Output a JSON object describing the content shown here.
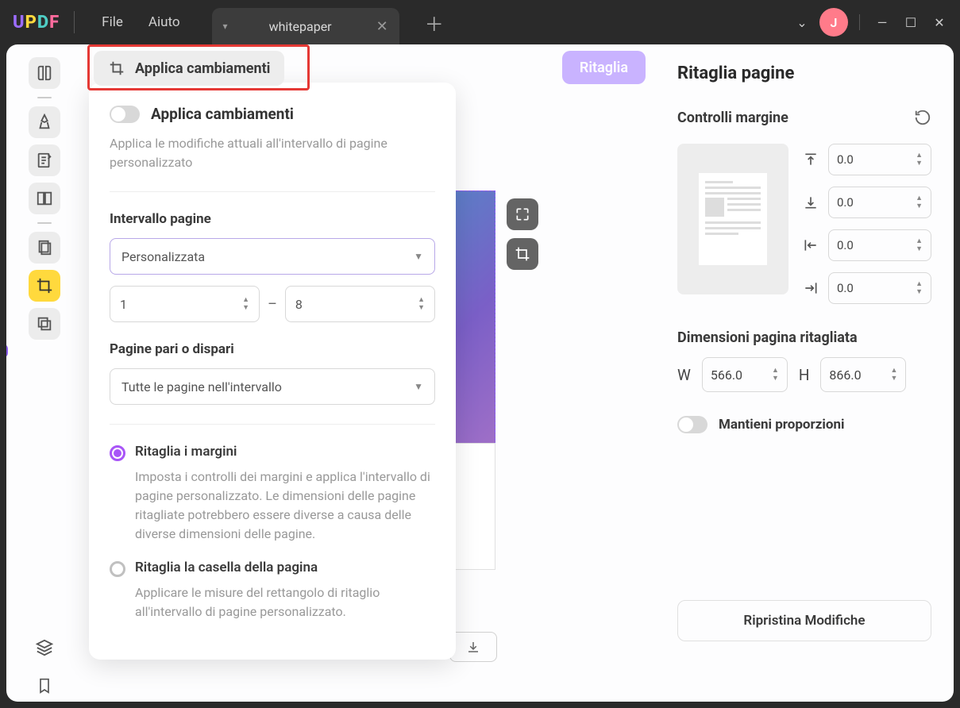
{
  "menu": {
    "file": "File",
    "help": "Aiuto"
  },
  "tab": {
    "title": "whitepaper"
  },
  "avatar_letter": "J",
  "apply_button": "Applica cambiamenti",
  "crop_button": "Ritaglia",
  "popover": {
    "title": "Applica cambiamenti",
    "desc": "Applica le modifiche attuali all'intervallo di pagine personalizzato",
    "range_label": "Intervallo pagine",
    "range_select": "Personalizzata",
    "from": "1",
    "to": "8",
    "odd_even_label": "Pagine pari o dispari",
    "odd_even_select": "Tutte le pagine nell'intervallo",
    "opt1_label": "Ritaglia i margini",
    "opt1_desc": "Imposta i controlli dei margini e applica l'intervallo di pagine personalizzato. Le dimensioni delle pagine ritagliate potrebbero essere diverse a causa delle diverse dimensioni delle pagine.",
    "opt2_label": "Ritaglia la casella della pagina",
    "opt2_desc": "Applicare le misure del rettangolo di ritaglio all'intervallo di pagine personalizzato."
  },
  "right": {
    "title": "Ritaglia pagine",
    "margin_label": "Controlli margine",
    "top": "0.0",
    "bottom": "0.0",
    "left": "0.0",
    "right_v": "0.0",
    "dim_label": "Dimensioni pagina ritagliata",
    "w": "W",
    "h": "H",
    "w_val": "566.0",
    "h_val": "866.0",
    "keep_ratio": "Mantieni proporzioni",
    "restore": "Ripristina Modifiche"
  }
}
